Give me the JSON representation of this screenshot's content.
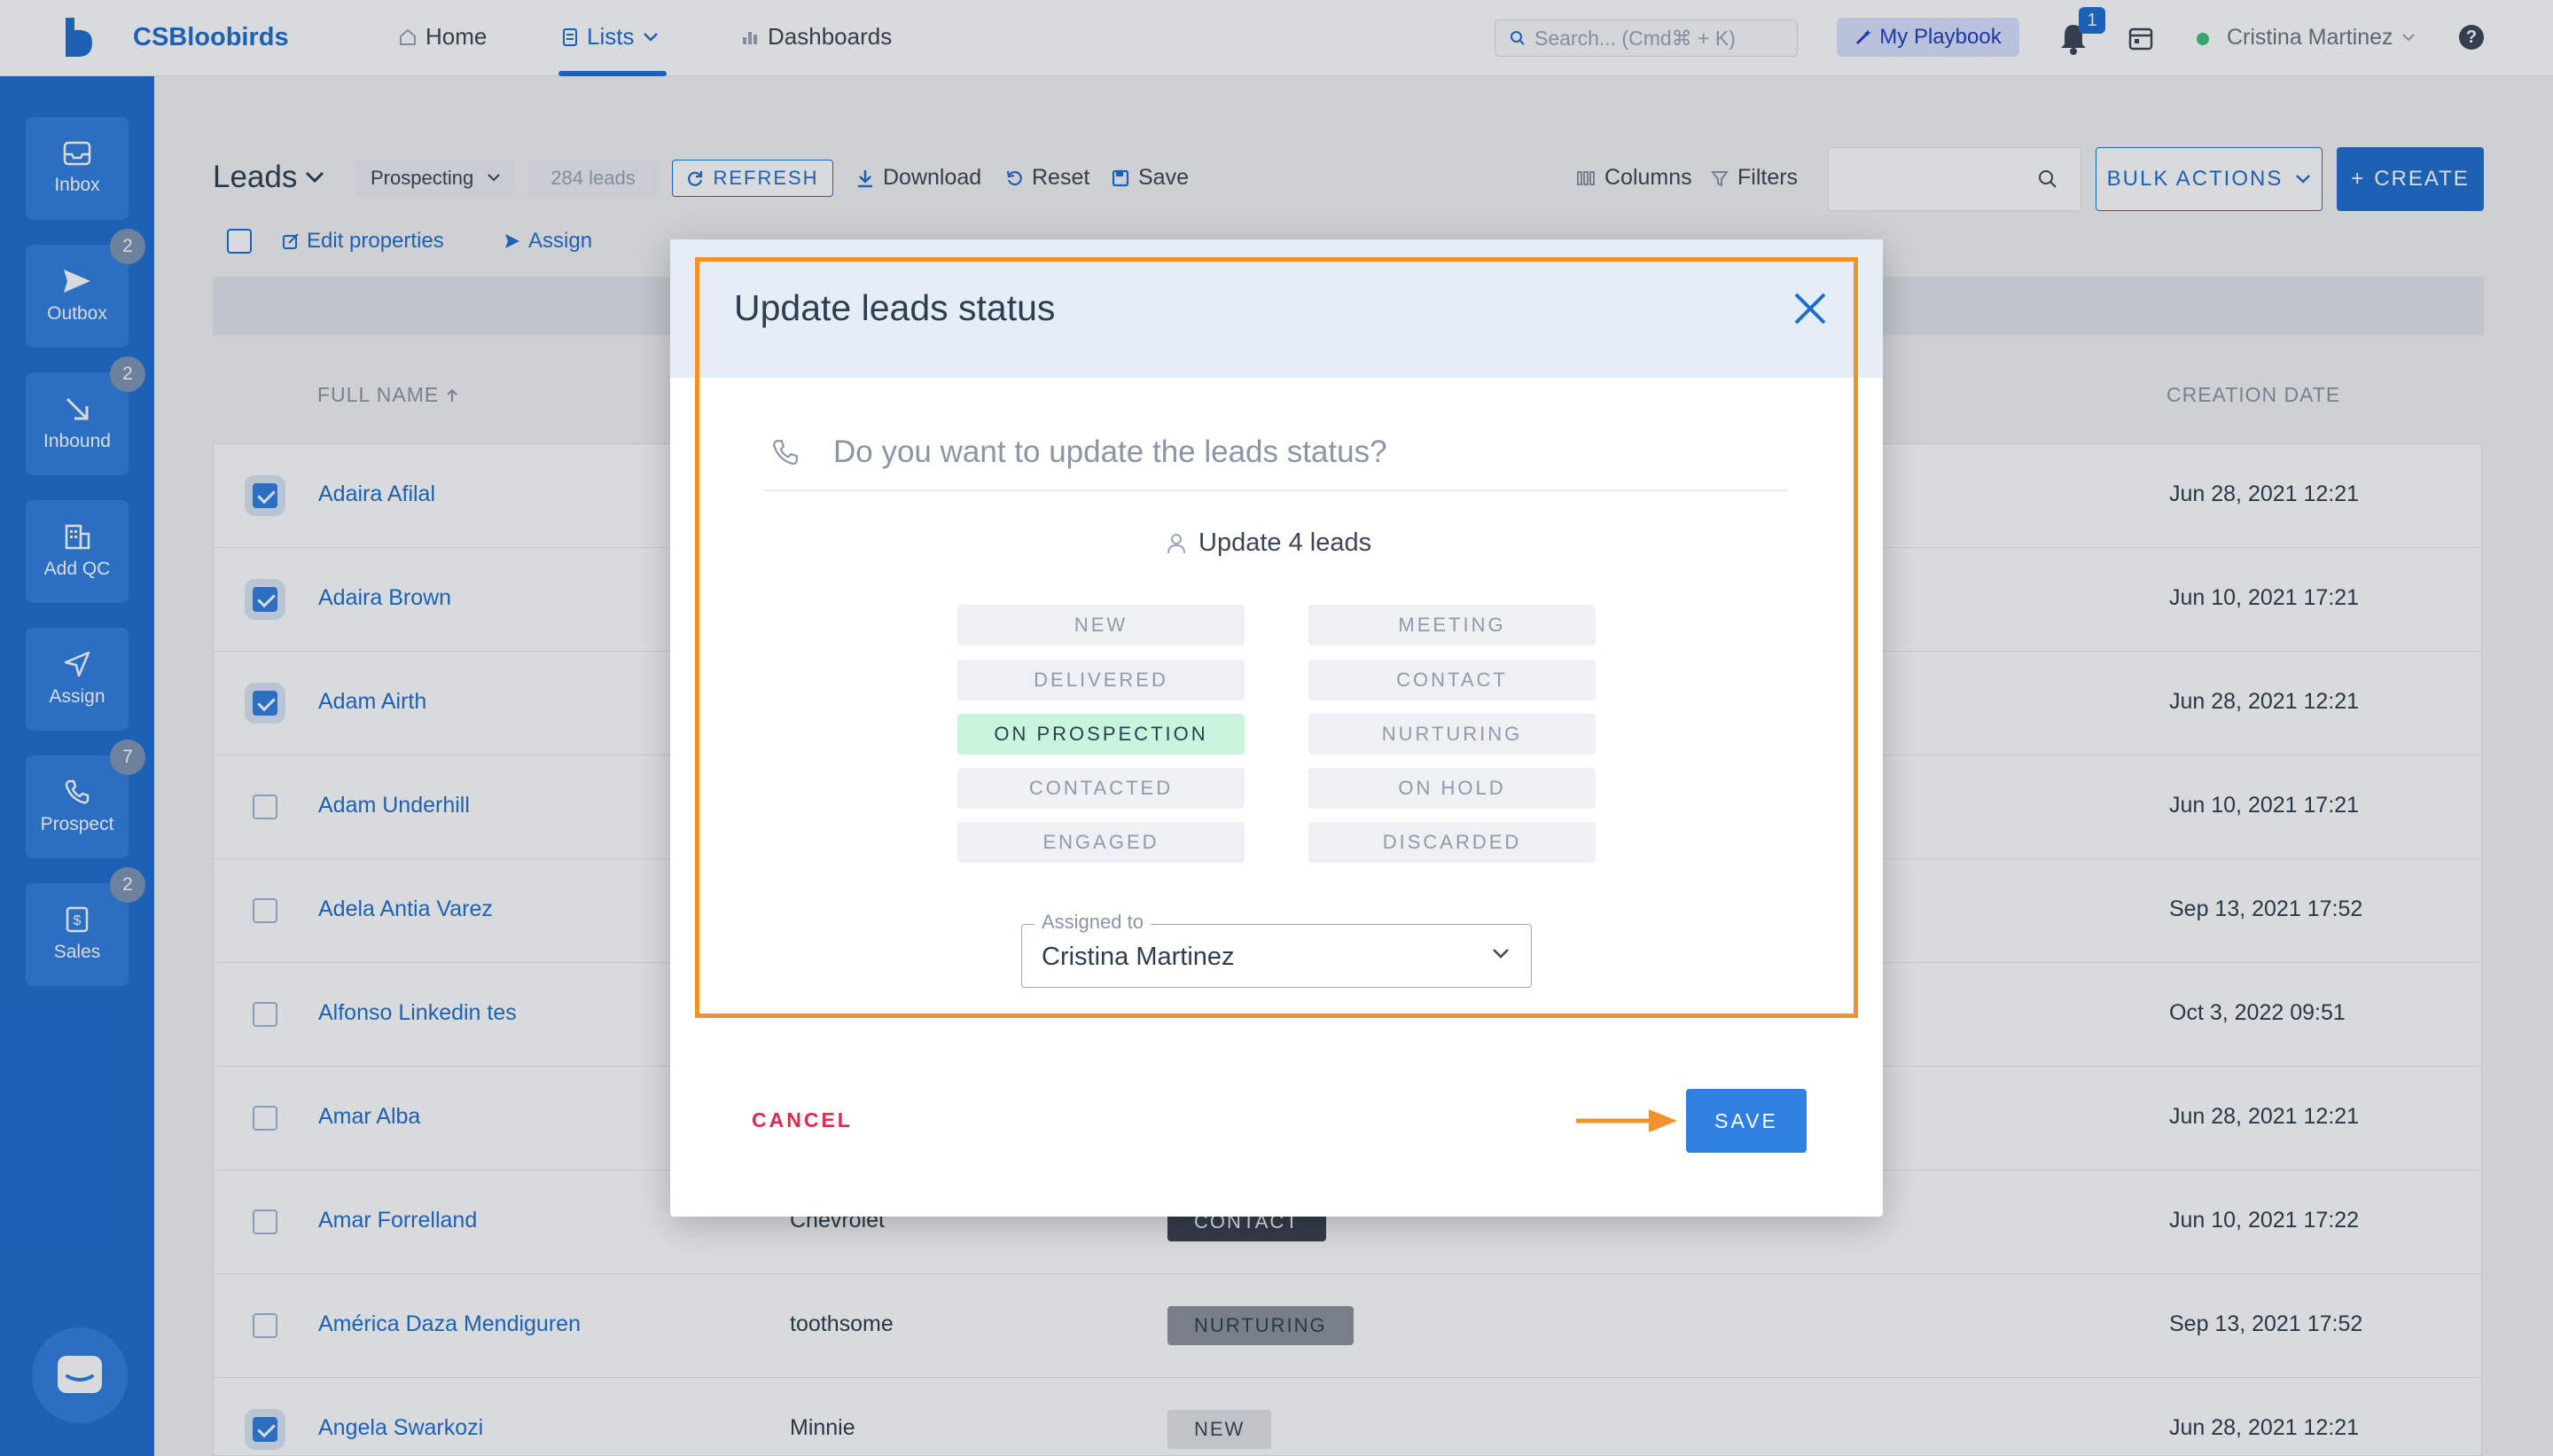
{
  "header": {
    "brand": "CSBloobirds",
    "nav": [
      {
        "label": "Home",
        "icon": "home-icon"
      },
      {
        "label": "Lists",
        "icon": "list-icon"
      },
      {
        "label": "Dashboards",
        "icon": "bar-chart-icon"
      }
    ],
    "search_placeholder": "Search... (Cmd⌘ + K)",
    "playbook_label": "My Playbook",
    "notification_count": "1",
    "user_name": "Cristina Martinez",
    "help_label": "?"
  },
  "sidebar": {
    "items": [
      {
        "label": "Inbox",
        "icon": "inbox-icon",
        "badge": ""
      },
      {
        "label": "Outbox",
        "icon": "send-icon",
        "badge": "2"
      },
      {
        "label": "Inbound",
        "icon": "arrow-down-right-icon",
        "badge": "2"
      },
      {
        "label": "Add QC",
        "icon": "building-icon",
        "badge": ""
      },
      {
        "label": "Assign",
        "icon": "navigation-icon",
        "badge": ""
      },
      {
        "label": "Prospect",
        "icon": "phone-icon",
        "badge": "7"
      },
      {
        "label": "Sales",
        "icon": "dollar-icon",
        "badge": "2"
      }
    ]
  },
  "toolbar": {
    "title": "Leads",
    "view": "Prospecting",
    "count": "284 leads",
    "refresh": "REFRESH",
    "download": "Download",
    "reset": "Reset",
    "save": "Save",
    "columns": "Columns",
    "filters": "Filters",
    "bulk_actions": "BULK ACTIONS",
    "create": "CREATE"
  },
  "actions": {
    "edit_properties": "Edit properties",
    "assign": "Assign"
  },
  "table": {
    "headers": {
      "full_name": "FULL NAME",
      "creation_date": "CREATION DATE"
    },
    "rows": [
      {
        "name": "Adaira Afilal",
        "company": "",
        "status": "",
        "date": "Jun 28, 2021 12:21",
        "checked": true
      },
      {
        "name": "Adaira Brown",
        "company": "",
        "status": "",
        "date": "Jun 10, 2021 17:21",
        "checked": true
      },
      {
        "name": "Adam Airth",
        "company": "",
        "status": "",
        "date": "Jun 28, 2021 12:21",
        "checked": true
      },
      {
        "name": "Adam Underhill",
        "company": "",
        "status": "",
        "date": "Jun 10, 2021 17:21",
        "checked": false
      },
      {
        "name": "Adela Antia Varez",
        "company": "",
        "status": "",
        "date": "Sep 13, 2021 17:52",
        "checked": false
      },
      {
        "name": "Alfonso Linkedin tes",
        "company": "",
        "status": "",
        "date": "Oct 3, 2022 09:51",
        "checked": false
      },
      {
        "name": "Amar Alba",
        "company": "",
        "status": "",
        "date": "Jun 28, 2021 12:21",
        "checked": false
      },
      {
        "name": "Amar Forrelland",
        "company": "Chevrolet",
        "status": "CONTACT",
        "date": "Jun 10, 2021 17:22",
        "checked": false
      },
      {
        "name": "América Daza Mendiguren",
        "company": "toothsome",
        "status": "NURTURING",
        "date": "Sep 13, 2021 17:52",
        "checked": false
      },
      {
        "name": "Angela Swarkozi",
        "company": "Minnie",
        "status": "NEW",
        "date": "Jun 28, 2021 12:21",
        "checked": true
      }
    ]
  },
  "modal": {
    "title": "Update leads status",
    "question": "Do you want to update the leads status?",
    "update_count": "Update 4 leads",
    "statuses_left": [
      "NEW",
      "DELIVERED",
      "ON PROSPECTION",
      "CONTACTED",
      "ENGAGED"
    ],
    "statuses_right": [
      "MEETING",
      "CONTACT",
      "NURTURING",
      "ON HOLD",
      "DISCARDED"
    ],
    "selected_status": "ON PROSPECTION",
    "assigned_label": "Assigned to",
    "assigned_value": "Cristina Martinez",
    "cancel": "CANCEL",
    "save": "SAVE"
  },
  "colors": {
    "accent": "#1f6fd1",
    "selected_status": "#c9f5dd",
    "highlight": "#f0922e",
    "cancel": "#e0294c"
  }
}
